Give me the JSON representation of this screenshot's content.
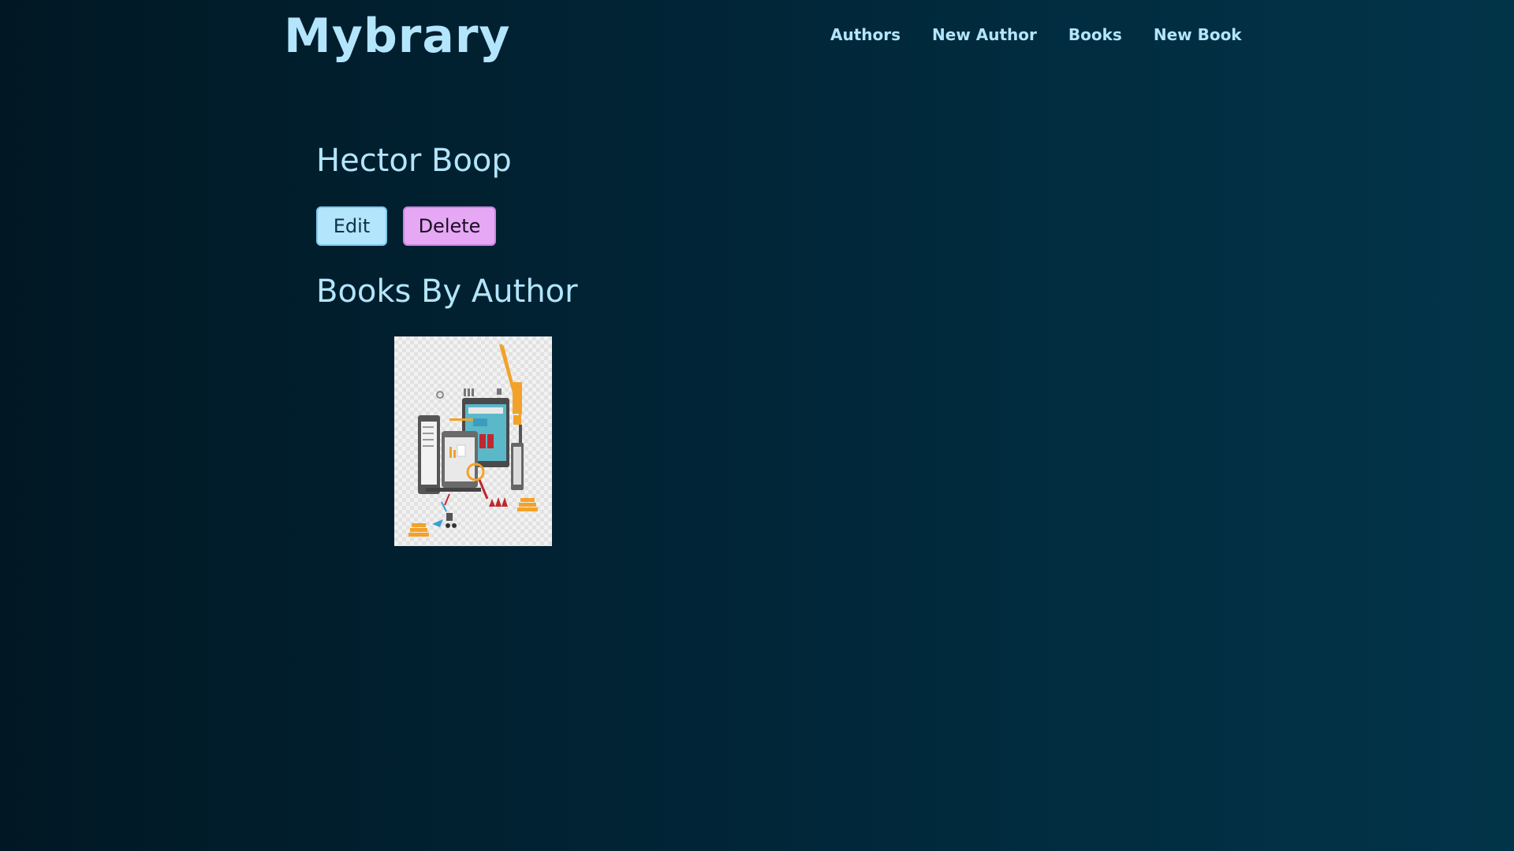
{
  "app": {
    "logo": "Mybrary"
  },
  "nav": {
    "items": [
      {
        "label": "Authors"
      },
      {
        "label": "New Author"
      },
      {
        "label": "Books"
      },
      {
        "label": "New Book"
      }
    ]
  },
  "author": {
    "name": "Hector Boop"
  },
  "actions": {
    "edit_label": "Edit",
    "delete_label": "Delete"
  },
  "books_section": {
    "title": "Books By Author",
    "books": [
      {
        "cover_icon": "book-cover-illustration-devices-crane"
      }
    ]
  },
  "colors": {
    "text_accent": "#b3e5fc",
    "edit_button": "#b3e5fc",
    "delete_button": "#e6a7f5",
    "background_dark": "#011824",
    "background_light": "#023449"
  }
}
